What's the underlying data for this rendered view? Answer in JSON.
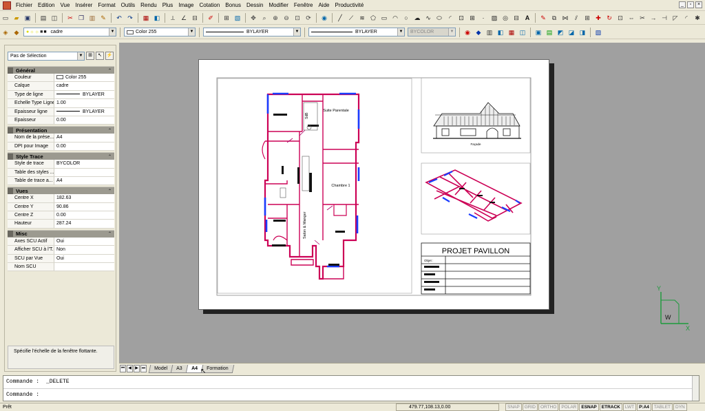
{
  "menu": [
    "Fichier",
    "Edition",
    "Vue",
    "Insérer",
    "Format",
    "Outils",
    "Rendu",
    "Plus",
    "Image",
    "Cotation",
    "Bonus",
    "Dessin",
    "Modifier",
    "Fenêtre",
    "Aide",
    "Productivité"
  ],
  "toolbar2": {
    "layer_value": "cadre",
    "color_value": "Color 255",
    "linetype_value": "BYLAYER",
    "lineweight_value": "BYLAYER",
    "plotstyle_value": "BYCOLOR"
  },
  "props": {
    "selection": "Pas de Sélection",
    "categories": [
      {
        "title": "Général",
        "rows": [
          {
            "k": "Couleur",
            "v": "Color 255"
          },
          {
            "k": "Calque",
            "v": "cadre"
          },
          {
            "k": "Type de ligne",
            "v": "BYLAYER"
          },
          {
            "k": "Echelle Type Ligne",
            "v": "1.00"
          },
          {
            "k": "Epaisseur ligne",
            "v": "BYLAYER"
          },
          {
            "k": "Epaisseur",
            "v": "0.00"
          }
        ]
      },
      {
        "title": "Présentation",
        "rows": [
          {
            "k": "Nom de la prése...",
            "v": "A4"
          },
          {
            "k": "DPI pour Image",
            "v": "0.00"
          }
        ]
      },
      {
        "title": "Style Trace",
        "rows": [
          {
            "k": "Style de trace",
            "v": "BYCOLOR"
          },
          {
            "k": "Table des styles ...",
            "v": ""
          },
          {
            "k": "Table de trace a...",
            "v": "A4"
          }
        ]
      },
      {
        "title": "Vues",
        "rows": [
          {
            "k": "Centre X",
            "v": "182.63"
          },
          {
            "k": "Centre Y",
            "v": "90.86"
          },
          {
            "k": "Centre Z",
            "v": "0.00"
          },
          {
            "k": "Hauteur",
            "v": "287.24"
          }
        ]
      },
      {
        "title": "Misc",
        "rows": [
          {
            "k": "Axes SCU Actif",
            "v": "Oui"
          },
          {
            "k": "Afficher SCU à l'T...",
            "v": "Non"
          },
          {
            "k": "SCU par Vue",
            "v": "Oui"
          },
          {
            "k": "Nom SCU",
            "v": ""
          }
        ]
      }
    ],
    "help": "Spécifie l'échelle de la fenêtre flottante."
  },
  "drawing": {
    "room_suite": "Suite Parentale",
    "room_sdb": "SdB",
    "room_chambre": "Chambre 1",
    "room_salon": "Salon & Manger",
    "elevation_caption": "Façade",
    "title_block": "PROJET PAVILLON",
    "title_field": "Objet :"
  },
  "tabs": [
    "Model",
    "A3",
    "A4",
    "Formation"
  ],
  "active_tab": "A4",
  "command": {
    "label": "Commande :",
    "history": "_DELETE",
    "prompt": ""
  },
  "status": {
    "text": "Prêt",
    "coords": "479.77,108.13,0.00",
    "toggles": [
      {
        "label": "SNAP",
        "on": false
      },
      {
        "label": "GRID",
        "on": false
      },
      {
        "label": "ORTHO",
        "on": false
      },
      {
        "label": "POLAR",
        "on": false
      },
      {
        "label": "ESNAP",
        "on": true
      },
      {
        "label": "ETRACK",
        "on": true
      },
      {
        "label": "LWT",
        "on": false
      },
      {
        "label": "P:A4",
        "on": true
      },
      {
        "label": "TABLET",
        "on": false
      },
      {
        "label": "DYN",
        "on": false
      }
    ]
  },
  "ucs": {
    "x": "X",
    "y": "Y",
    "w": "W"
  },
  "colors": {
    "accent": "#cc0055",
    "blue": "#1a3cff",
    "workspace": "#a0a0a0"
  }
}
